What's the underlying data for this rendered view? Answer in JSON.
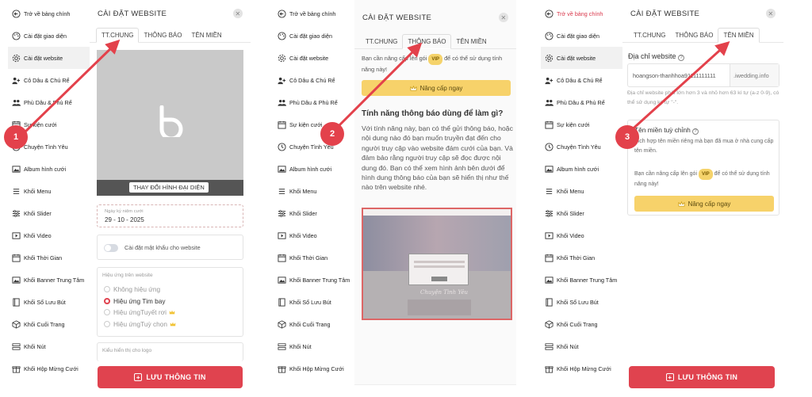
{
  "sidebar": {
    "back": "Trở về bảng chính",
    "items": [
      "Cài đặt giao diện",
      "Cài đặt website",
      "Cô Dâu & Chú Rể",
      "Phù Dâu & Phù Rể",
      "Sự kiện cưới",
      "Chuyện Tình Yêu",
      "Album hình cưới",
      "Khối Menu",
      "Khối Slider",
      "Khối Video",
      "Khối Thời Gian",
      "Khối Banner Trung Tâm",
      "Khối Sổ Lưu Bút",
      "Khối Cuối Trang",
      "Khối Nút",
      "Khối Hộp Mừng Cưới"
    ],
    "icons": [
      "back-circle-icon",
      "palette-icon",
      "gear-icon",
      "couple-icon",
      "group-icon",
      "calendar-icon",
      "clock-icon",
      "image-icon",
      "menu-icon",
      "slider-icon",
      "video-icon",
      "calendar-icon",
      "image-icon",
      "book-icon",
      "cube-icon",
      "button-icon",
      "gift-icon"
    ]
  },
  "settings": {
    "title": "CÀI ĐẶT WEBSITE",
    "tabs": [
      "TT.CHUNG",
      "THÔNG BÁO",
      "TÊN MIỀN"
    ],
    "save_label": "LƯU THÔNG TIN"
  },
  "general": {
    "change_avatar": "THAY ĐỔI HÌNH ĐẠI DIỆN",
    "wedding_date_label": "Ngày kỷ niệm cưới",
    "wedding_date_value": "29 - 10 - 2025",
    "password_toggle_label": "Cài đặt mật khẩu cho website",
    "effect_title": "Hiệu ứng trên website",
    "effects": [
      "Không hiệu ứng",
      "Hiệu ứng Tim bay",
      "Hiệu ứngTuyết rơi",
      "Hiệu ứngTuỳ chọn"
    ],
    "logo_label": "Kiểu hiển thị cho logo"
  },
  "notification": {
    "upgrade_text_a": "Bạn cần nâng cấp lên gói",
    "vip": "VIP",
    "upgrade_text_b": "để có thể sử dụng tính năng này!",
    "upgrade_button": "Nâng cấp ngay",
    "heading": "Tính năng thông báo dùng để làm gì?",
    "body": "Với tính năng này, bạn có thể gửi thông báo, hoặc nội dung nào đó bạn muốn truyền đạt đến cho người truy cập vào website đám cưới của bạn. Và đảm bảo rằng người truy cập sẽ đọc được nội dung đó. Bạn có thể xem hình ảnh bên dưới để hình dung thông báo của bạn sẽ hiển thị như thế nào trên website nhé.",
    "preview_caption": "Chuyện Tình Yêu"
  },
  "domain": {
    "address_label": "Địa chỉ website",
    "subdomain_value": "hoangson-thanhhoa91111111111",
    "suffix": ".iwedding.info",
    "rule_text": "Địa chỉ website phải lớn hơn 3 và nhỏ hơn 63 kí tự (a-z 0-9), có thể sử dụng ký tự \"-\".",
    "custom_title": "Tên miền tuỳ chỉnh",
    "custom_desc": "Tích hợp tên miền riêng mà bạn đã mua ở nhà cung cấp tên miền.",
    "upgrade_text_a": "Bạn cần nâng cấp lên gói",
    "vip": "VIP",
    "upgrade_text_b": "để có thể sử dụng tính năng này!",
    "upgrade_button": "Nâng cấp ngay"
  },
  "markers": [
    "1",
    "2",
    "3"
  ],
  "colors": {
    "accent_red": "#e0434f",
    "vip_yellow": "#f7d26a",
    "marker_red": "#e3414b"
  }
}
